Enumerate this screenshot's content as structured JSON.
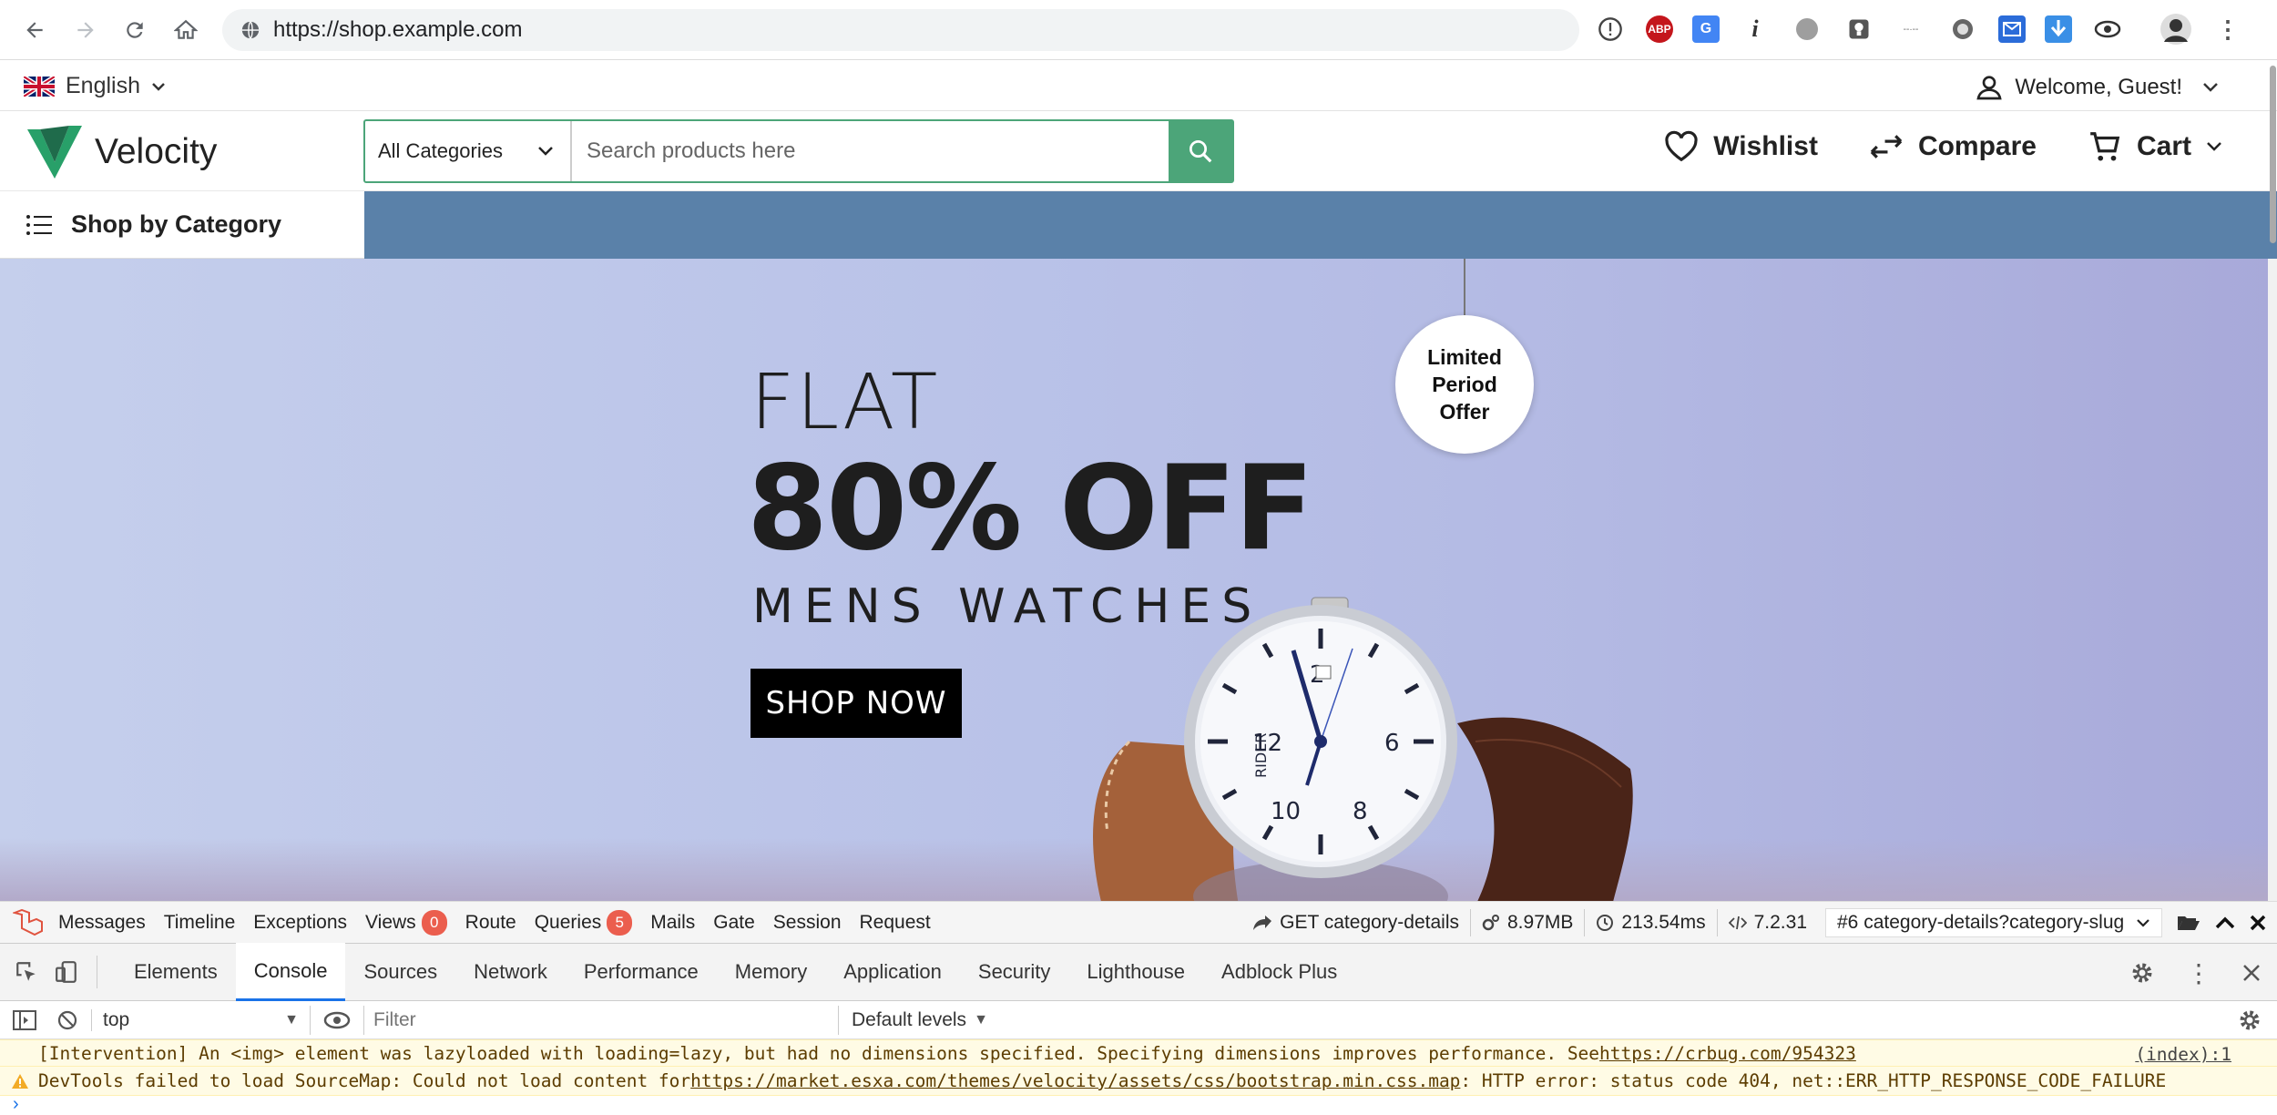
{
  "browser": {
    "url": "https://shop.example.com",
    "extensions": [
      "info-icon",
      "adblock-icon",
      "translate-icon",
      "italic-i-icon",
      "gray-circle-icon",
      "bulb-icon",
      "dash-text-icon",
      "half-circle-icon",
      "mail-icon",
      "download-arrow-icon",
      "eye-icon",
      "avatar-icon"
    ],
    "adblock_label": "ABP"
  },
  "topbar": {
    "language": "English",
    "welcome": "Welcome, Guest!"
  },
  "header": {
    "logo": "Velocity",
    "category_select": "All Categories",
    "search_placeholder": "Search products here",
    "wishlist": "Wishlist",
    "compare": "Compare",
    "cart": "Cart",
    "accent_color": "#4ca579"
  },
  "catbar": {
    "shop_by_category": "Shop by Category",
    "bar_color": "#5a81a9"
  },
  "banner": {
    "flat": "FLAT",
    "discount": "80% OFF",
    "subtitle": "MENS WATCHES",
    "button": "SHOP NOW",
    "tag_line1": "Limited",
    "tag_line2": "Period",
    "tag_line3": "Offer",
    "watch_brand": "RIDER"
  },
  "debugbar": {
    "items": [
      {
        "label": "Messages"
      },
      {
        "label": "Timeline"
      },
      {
        "label": "Exceptions"
      },
      {
        "label": "Views",
        "badge": "0"
      },
      {
        "label": "Route"
      },
      {
        "label": "Queries",
        "badge": "5"
      },
      {
        "label": "Mails"
      },
      {
        "label": "Gate"
      },
      {
        "label": "Session"
      },
      {
        "label": "Request"
      }
    ],
    "request": "GET category-details",
    "memory": "8.97MB",
    "time": "213.54ms",
    "php_version": "7.2.31",
    "route_select": "#6 category-details?category-slug"
  },
  "devtools": {
    "tabs": [
      "Elements",
      "Console",
      "Sources",
      "Network",
      "Performance",
      "Memory",
      "Application",
      "Security",
      "Lighthouse",
      "Adblock Plus"
    ],
    "active_tab": "Console",
    "context": "top",
    "filter_placeholder": "Filter",
    "levels": "Default levels",
    "messages": [
      {
        "text": "[Intervention] An <img> element was lazyloaded with loading=lazy, but had no dimensions specified. Specifying dimensions improves performance. See ",
        "link": "https://crbug.com/954323",
        "source": "(index):1"
      },
      {
        "text": "DevTools failed to load SourceMap: Could not load content for ",
        "link": "https://market.esxa.com/themes/velocity/assets/css/bootstrap.min.css.map",
        "suffix": ": HTTP error: status code 404, net::ERR_HTTP_RESPONSE_CODE_FAILURE"
      }
    ]
  }
}
